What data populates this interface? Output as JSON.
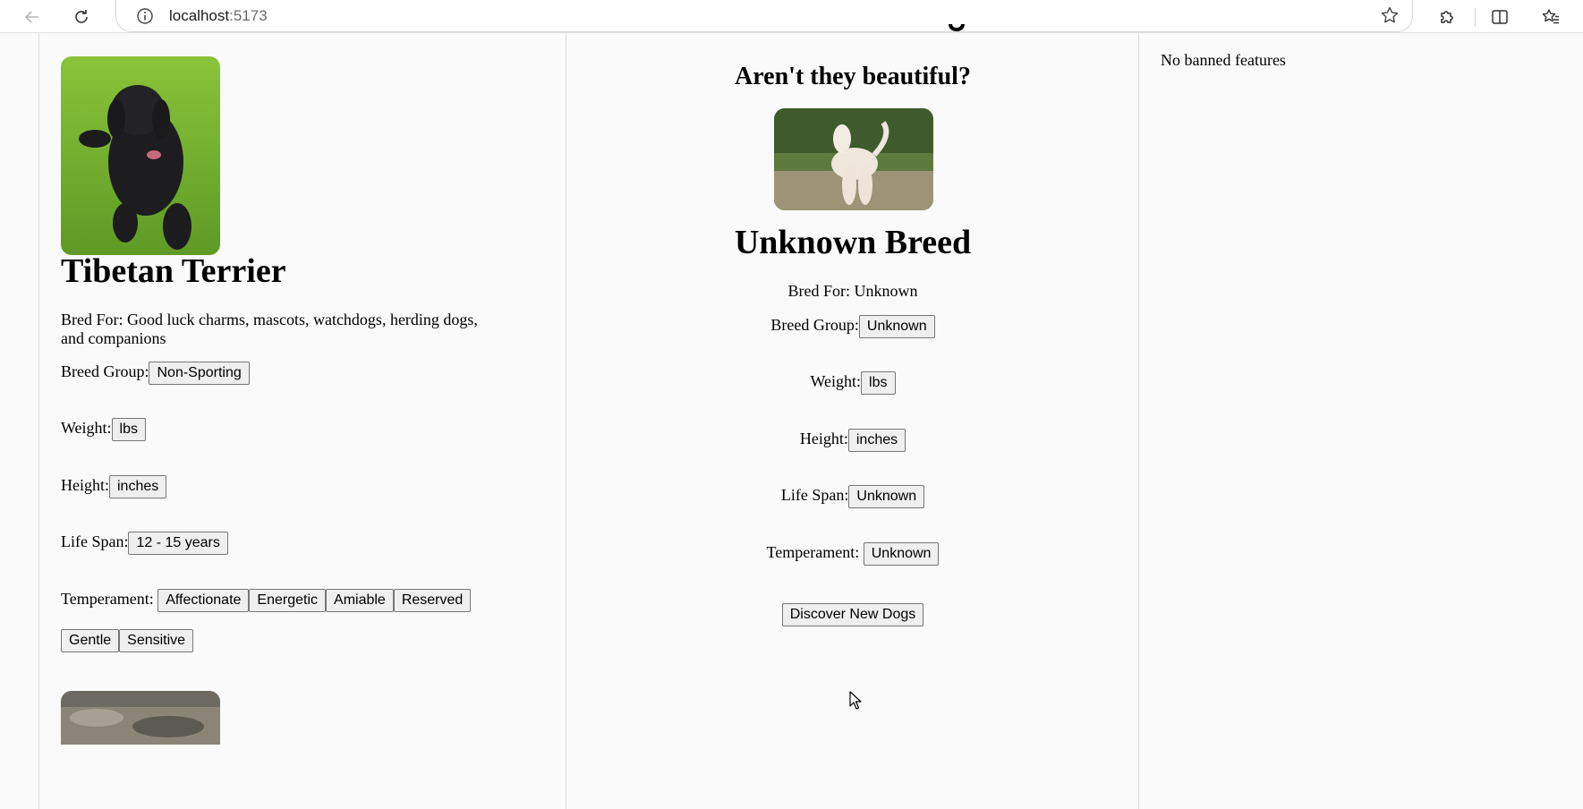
{
  "browser": {
    "url_host": "localhost",
    "url_port": ":5173"
  },
  "left_card": {
    "name": "Tibetan Terrier",
    "bred_for_label": "Bred For:",
    "bred_for": "Good luck charms, mascots, watchdogs, herding dogs, and companions",
    "breed_group_label": "Breed Group:",
    "breed_group": "Non-Sporting",
    "weight_label": "Weight:",
    "weight": "lbs",
    "height_label": "Height:",
    "height": "inches",
    "life_span_label": "Life Span:",
    "life_span": "12 - 15 years",
    "temperament_label": "Temperament:",
    "temperament": [
      "Affectionate",
      "Energetic",
      "Amiable",
      "Reserved",
      "Gentle",
      "Sensitive"
    ]
  },
  "main": {
    "subtitle": "Aren't they beautiful?",
    "name": "Unknown Breed",
    "bred_for": "Bred For: Unknown",
    "breed_group_label": "Breed Group:",
    "breed_group": "Unknown",
    "weight_label": "Weight:",
    "weight": "lbs",
    "height_label": "Height:",
    "height": "inches",
    "life_span_label": "Life Span:",
    "life_span": "Unknown",
    "temperament_label": "Temperament:",
    "temperament": "Unknown",
    "discover_button": "Discover New Dogs"
  },
  "ban_list": {
    "empty_text": "No banned features"
  }
}
